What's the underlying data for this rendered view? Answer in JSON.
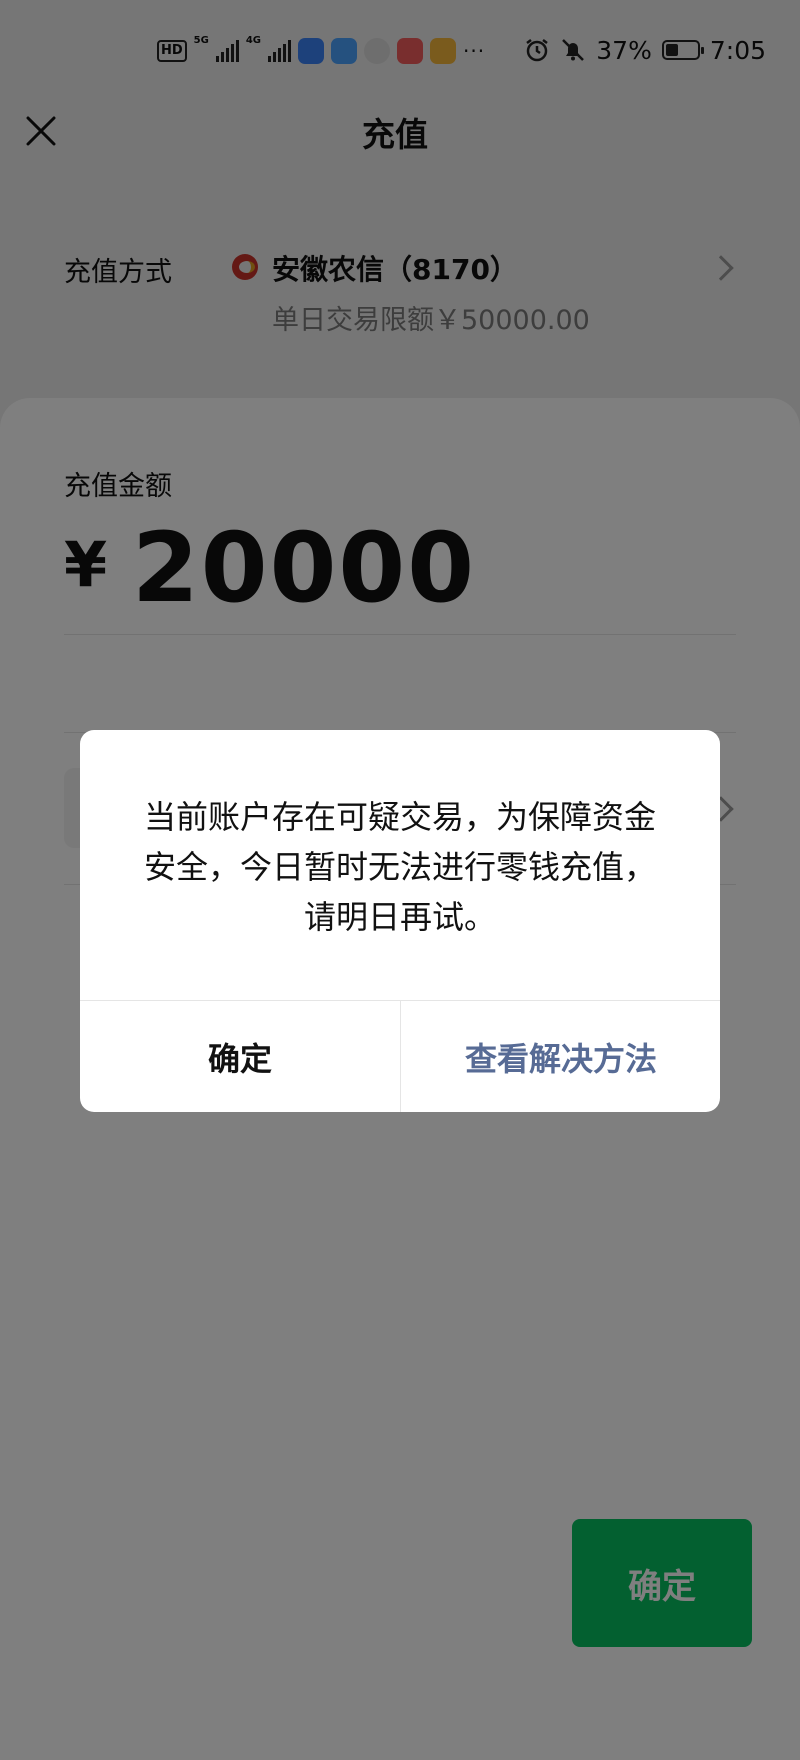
{
  "status_bar": {
    "hd": "HD",
    "sim1_net": "5G",
    "sim2_net": "4G",
    "battery": "37%",
    "time": "7:05",
    "more": "···",
    "app_colors": [
      "#3b82f6",
      "#4aa3ff",
      "#dddddd",
      "#f25c5c",
      "#f5b73b"
    ]
  },
  "nav": {
    "title": "充值",
    "close_icon": "close-icon"
  },
  "method": {
    "label": "充值方式",
    "bank": "安徽农信（8170）",
    "limit": "单日交易限额￥50000.00"
  },
  "amount": {
    "label": "充值金额",
    "currency": "¥",
    "value": "20000"
  },
  "confirm_button": "确定",
  "dialog": {
    "message": "当前账户存在可疑交易，为保障资金安全，今日暂时无法进行零钱充值，请明日再试。",
    "ok": "确定",
    "solution": "查看解决方法"
  },
  "colors": {
    "accent_green": "#07c160",
    "link_blue": "#576b95"
  }
}
